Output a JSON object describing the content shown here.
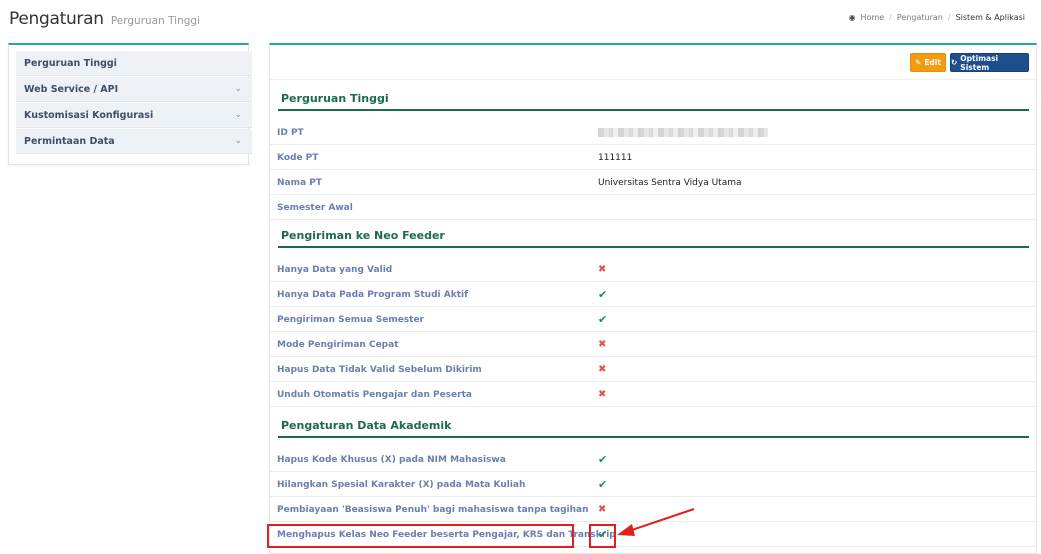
{
  "header": {
    "title": "Pengaturan",
    "subtitle": "Perguruan Tinggi",
    "breadcrumb": [
      {
        "label": "Home"
      },
      {
        "label": "Pengaturan"
      },
      {
        "label": "Sistem & Aplikasi"
      }
    ]
  },
  "sidebar": {
    "items": [
      {
        "label": "Perguruan Tinggi",
        "has_chevron": false
      },
      {
        "label": "Web Service / API",
        "has_chevron": true
      },
      {
        "label": "Kustomisasi Konfigurasi",
        "has_chevron": true
      },
      {
        "label": "Permintaan Data",
        "has_chevron": true
      }
    ]
  },
  "toolbar": {
    "edit_label": "Edit",
    "optimize_label": "Optimasi Sistem"
  },
  "sections": [
    {
      "title": "Perguruan Tinggi",
      "rows": [
        {
          "label": "ID PT",
          "value": "",
          "redacted": true
        },
        {
          "label": "Kode PT",
          "value": "111111"
        },
        {
          "label": "Nama PT",
          "value": "Universitas Sentra Vidya Utama"
        },
        {
          "label": "Semester Awal",
          "value": ""
        }
      ]
    },
    {
      "title": "Pengiriman ke Neo Feeder",
      "rows": [
        {
          "label": "Hanya Data yang Valid",
          "status": "no"
        },
        {
          "label": "Hanya Data Pada Program Studi Aktif",
          "status": "yes"
        },
        {
          "label": "Pengiriman Semua Semester",
          "status": "yes"
        },
        {
          "label": "Mode Pengiriman Cepat",
          "status": "no"
        },
        {
          "label": "Hapus Data Tidak Valid Sebelum Dikirim",
          "status": "no"
        },
        {
          "label": "Unduh Otomatis Pengajar dan Peserta",
          "status": "no"
        }
      ]
    },
    {
      "title": "Pengaturan Data Akademik",
      "rows": [
        {
          "label": "Hapus Kode Khusus (X) pada NIM Mahasiswa",
          "status": "yes"
        },
        {
          "label": "Hilangkan Spesial Karakter (X) pada Mata Kuliah",
          "status": "yes"
        },
        {
          "label": "Pembiayaan 'Beasiswa Penuh' bagi mahasiswa tanpa tagihan",
          "status": "no"
        },
        {
          "label": "Menghapus Kelas Neo Feeder beserta Pengajar, KRS dan Transkrip",
          "status": "yes"
        }
      ]
    }
  ],
  "colors": {
    "accent_teal": "#26a69a",
    "section_green": "#1c6b4a",
    "check_green": "#1e8e4e",
    "cross_red": "#e0554a",
    "edit_orange": "#f39c12",
    "optimize_blue": "#1f4e8c",
    "highlight_red": "#e02020"
  }
}
